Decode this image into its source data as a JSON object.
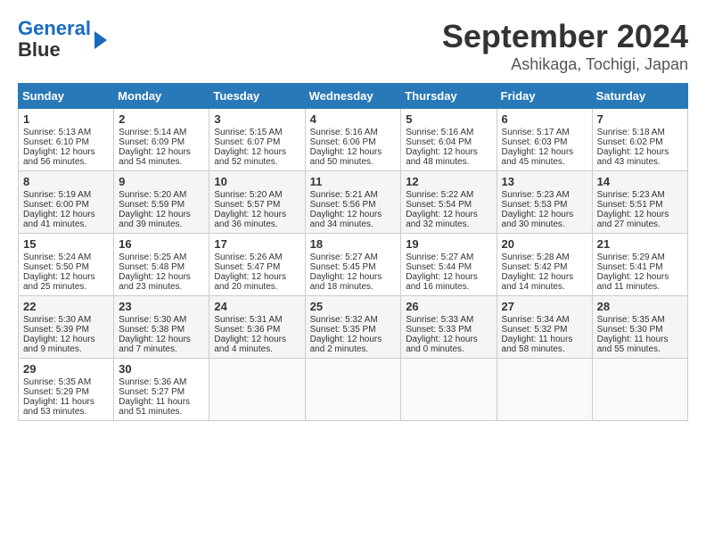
{
  "header": {
    "logo_line1": "General",
    "logo_line2": "Blue",
    "month": "September 2024",
    "location": "Ashikaga, Tochigi, Japan"
  },
  "weekdays": [
    "Sunday",
    "Monday",
    "Tuesday",
    "Wednesday",
    "Thursday",
    "Friday",
    "Saturday"
  ],
  "weeks": [
    [
      {
        "day": "1",
        "info": "Sunrise: 5:13 AM\nSunset: 6:10 PM\nDaylight: 12 hours\nand 56 minutes."
      },
      {
        "day": "2",
        "info": "Sunrise: 5:14 AM\nSunset: 6:09 PM\nDaylight: 12 hours\nand 54 minutes."
      },
      {
        "day": "3",
        "info": "Sunrise: 5:15 AM\nSunset: 6:07 PM\nDaylight: 12 hours\nand 52 minutes."
      },
      {
        "day": "4",
        "info": "Sunrise: 5:16 AM\nSunset: 6:06 PM\nDaylight: 12 hours\nand 50 minutes."
      },
      {
        "day": "5",
        "info": "Sunrise: 5:16 AM\nSunset: 6:04 PM\nDaylight: 12 hours\nand 48 minutes."
      },
      {
        "day": "6",
        "info": "Sunrise: 5:17 AM\nSunset: 6:03 PM\nDaylight: 12 hours\nand 45 minutes."
      },
      {
        "day": "7",
        "info": "Sunrise: 5:18 AM\nSunset: 6:02 PM\nDaylight: 12 hours\nand 43 minutes."
      }
    ],
    [
      {
        "day": "8",
        "info": "Sunrise: 5:19 AM\nSunset: 6:00 PM\nDaylight: 12 hours\nand 41 minutes."
      },
      {
        "day": "9",
        "info": "Sunrise: 5:20 AM\nSunset: 5:59 PM\nDaylight: 12 hours\nand 39 minutes."
      },
      {
        "day": "10",
        "info": "Sunrise: 5:20 AM\nSunset: 5:57 PM\nDaylight: 12 hours\nand 36 minutes."
      },
      {
        "day": "11",
        "info": "Sunrise: 5:21 AM\nSunset: 5:56 PM\nDaylight: 12 hours\nand 34 minutes."
      },
      {
        "day": "12",
        "info": "Sunrise: 5:22 AM\nSunset: 5:54 PM\nDaylight: 12 hours\nand 32 minutes."
      },
      {
        "day": "13",
        "info": "Sunrise: 5:23 AM\nSunset: 5:53 PM\nDaylight: 12 hours\nand 30 minutes."
      },
      {
        "day": "14",
        "info": "Sunrise: 5:23 AM\nSunset: 5:51 PM\nDaylight: 12 hours\nand 27 minutes."
      }
    ],
    [
      {
        "day": "15",
        "info": "Sunrise: 5:24 AM\nSunset: 5:50 PM\nDaylight: 12 hours\nand 25 minutes."
      },
      {
        "day": "16",
        "info": "Sunrise: 5:25 AM\nSunset: 5:48 PM\nDaylight: 12 hours\nand 23 minutes."
      },
      {
        "day": "17",
        "info": "Sunrise: 5:26 AM\nSunset: 5:47 PM\nDaylight: 12 hours\nand 20 minutes."
      },
      {
        "day": "18",
        "info": "Sunrise: 5:27 AM\nSunset: 5:45 PM\nDaylight: 12 hours\nand 18 minutes."
      },
      {
        "day": "19",
        "info": "Sunrise: 5:27 AM\nSunset: 5:44 PM\nDaylight: 12 hours\nand 16 minutes."
      },
      {
        "day": "20",
        "info": "Sunrise: 5:28 AM\nSunset: 5:42 PM\nDaylight: 12 hours\nand 14 minutes."
      },
      {
        "day": "21",
        "info": "Sunrise: 5:29 AM\nSunset: 5:41 PM\nDaylight: 12 hours\nand 11 minutes."
      }
    ],
    [
      {
        "day": "22",
        "info": "Sunrise: 5:30 AM\nSunset: 5:39 PM\nDaylight: 12 hours\nand 9 minutes."
      },
      {
        "day": "23",
        "info": "Sunrise: 5:30 AM\nSunset: 5:38 PM\nDaylight: 12 hours\nand 7 minutes."
      },
      {
        "day": "24",
        "info": "Sunrise: 5:31 AM\nSunset: 5:36 PM\nDaylight: 12 hours\nand 4 minutes."
      },
      {
        "day": "25",
        "info": "Sunrise: 5:32 AM\nSunset: 5:35 PM\nDaylight: 12 hours\nand 2 minutes."
      },
      {
        "day": "26",
        "info": "Sunrise: 5:33 AM\nSunset: 5:33 PM\nDaylight: 12 hours\nand 0 minutes."
      },
      {
        "day": "27",
        "info": "Sunrise: 5:34 AM\nSunset: 5:32 PM\nDaylight: 11 hours\nand 58 minutes."
      },
      {
        "day": "28",
        "info": "Sunrise: 5:35 AM\nSunset: 5:30 PM\nDaylight: 11 hours\nand 55 minutes."
      }
    ],
    [
      {
        "day": "29",
        "info": "Sunrise: 5:35 AM\nSunset: 5:29 PM\nDaylight: 11 hours\nand 53 minutes."
      },
      {
        "day": "30",
        "info": "Sunrise: 5:36 AM\nSunset: 5:27 PM\nDaylight: 11 hours\nand 51 minutes."
      },
      {
        "day": "",
        "info": ""
      },
      {
        "day": "",
        "info": ""
      },
      {
        "day": "",
        "info": ""
      },
      {
        "day": "",
        "info": ""
      },
      {
        "day": "",
        "info": ""
      }
    ]
  ]
}
